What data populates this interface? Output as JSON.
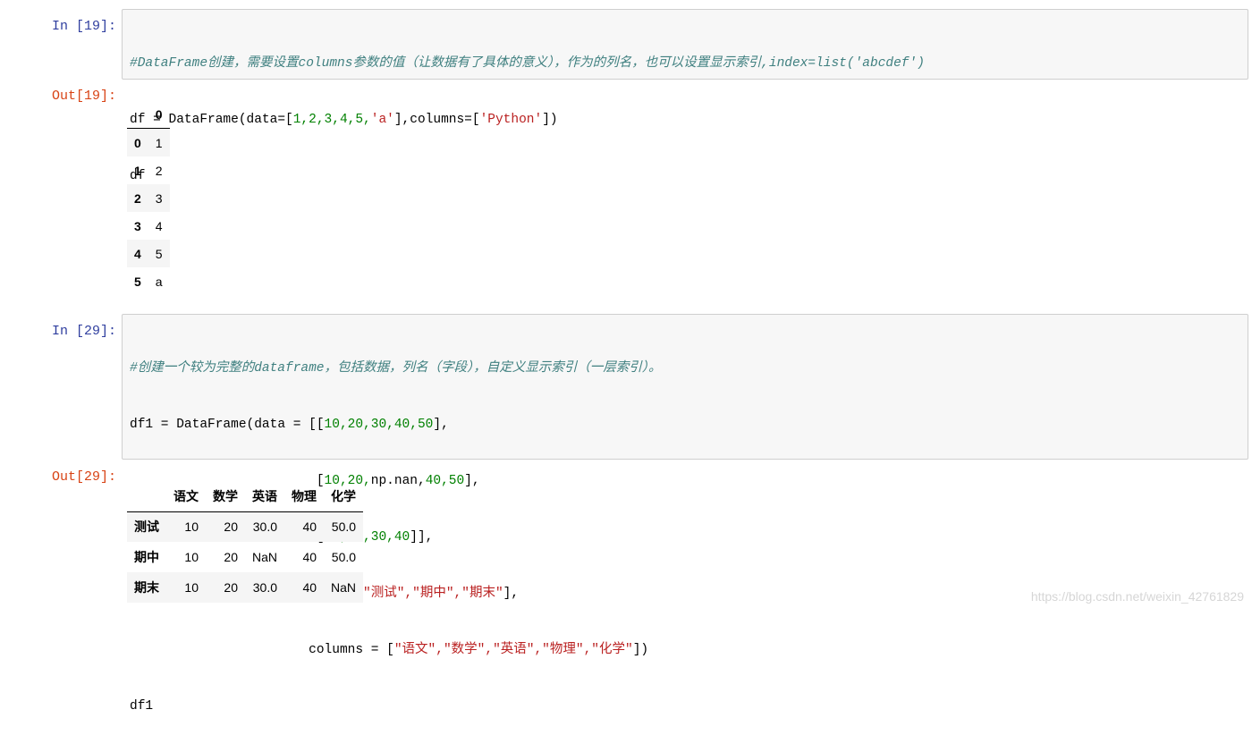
{
  "cell1": {
    "in_prompt": "In  [19]:",
    "out_prompt": "Out[19]:",
    "code_line1": "#DataFrame创建，需要设置columns参数的值（让数据有了具体的意义），作为的列名，也可以设置显示索引,index=list('abcdef')",
    "code_line2_a": "df = DataFrame(data=[",
    "code_line2_nums": "1,2,3,4,5,",
    "code_line2_str1": "'a'",
    "code_line2_b": "],columns=[",
    "code_line2_str2": "'Python'",
    "code_line2_c": "])",
    "code_line3": "df",
    "table": {
      "header": "0",
      "rows": [
        {
          "index": "0",
          "value": "1"
        },
        {
          "index": "1",
          "value": "2"
        },
        {
          "index": "2",
          "value": "3"
        },
        {
          "index": "3",
          "value": "4"
        },
        {
          "index": "4",
          "value": "5"
        },
        {
          "index": "5",
          "value": "a"
        }
      ]
    }
  },
  "cell2": {
    "in_prompt": "In  [29]:",
    "out_prompt": "Out[29]:",
    "code_line1": "#创建一个较为完整的dataframe，包括数据，列名（字段），自定义显示索引（一层索引）。",
    "code_line2_a": "df1 = DataFrame(data = [[",
    "code_line2_nums": "10,20,30,40,50",
    "code_line2_b": "],",
    "code_line3_pad": "                        [",
    "code_line3_nums1": "10,20,",
    "code_line3_mid": "np.nan,",
    "code_line3_nums2": "40,50",
    "code_line3_b": "],",
    "code_line4_pad": "                        [",
    "code_line4_nums": "10,20,30,40",
    "code_line4_b": "]],",
    "code_line5_pad": "                       index=[",
    "code_line5_strs": "\"测试\",\"期中\",\"期末\"",
    "code_line5_b": "],",
    "code_line6_pad": "                       columns = [",
    "code_line6_strs": "\"语文\",\"数学\",\"英语\",\"物理\",\"化学\"",
    "code_line6_b": "])",
    "code_line7": "df1",
    "table": {
      "columns": [
        "语文",
        "数学",
        "英语",
        "物理",
        "化学"
      ],
      "rows": [
        {
          "index": "测试",
          "values": [
            "10",
            "20",
            "30.0",
            "40",
            "50.0"
          ]
        },
        {
          "index": "期中",
          "values": [
            "10",
            "20",
            "NaN",
            "40",
            "50.0"
          ]
        },
        {
          "index": "期末",
          "values": [
            "10",
            "20",
            "30.0",
            "40",
            "NaN"
          ]
        }
      ]
    }
  },
  "watermark": "https://blog.csdn.net/weixin_42761829"
}
